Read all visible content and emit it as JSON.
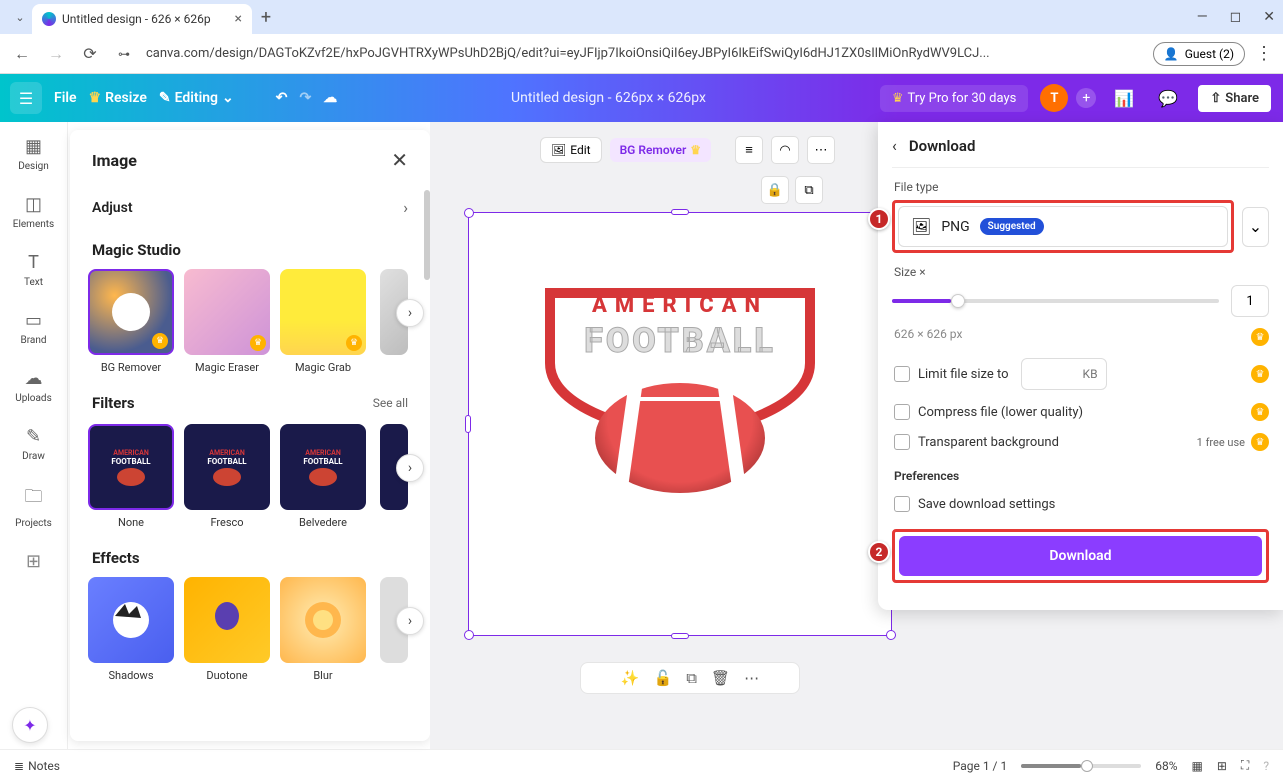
{
  "browser": {
    "tab_title": "Untitled design - 626 × 626p",
    "url": "canva.com/design/DAGToKZvf2E/hxPoJGVHTRXyWPsUhD2BjQ/edit?ui=eyJFIjp7IkoiOnsiQiI6eyJBPyI6IkEifSwiQyI6dHJ1ZX0sIlMiOnRydWV9LCJ...",
    "guest": "Guest (2)"
  },
  "appbar": {
    "file": "File",
    "resize": "Resize",
    "editing": "Editing",
    "title": "Untitled design - 626px × 626px",
    "try_pro": "Try Pro for 30 days",
    "avatar_initial": "T",
    "share": "Share"
  },
  "nav": {
    "design": "Design",
    "elements": "Elements",
    "text": "Text",
    "brand": "Brand",
    "uploads": "Uploads",
    "draw": "Draw",
    "projects": "Projects"
  },
  "panel": {
    "title": "Image",
    "adjust": "Adjust",
    "magic_studio": "Magic Studio",
    "ms": {
      "bgremover": "BG Remover",
      "eraser": "Magic Eraser",
      "grab": "Magic Grab"
    },
    "filters": "Filters",
    "see_all": "See all",
    "filter": {
      "none": "None",
      "fresco": "Fresco",
      "belvedere": "Belvedere"
    },
    "effects": "Effects",
    "fx": {
      "shadows": "Shadows",
      "duotone": "Duotone",
      "blur": "Blur"
    }
  },
  "canvas_toolbar": {
    "edit": "Edit",
    "bgremover": "BG Remover"
  },
  "logo": {
    "line1": "AMERICAN",
    "line2": "FOOTBALL"
  },
  "download": {
    "title": "Download",
    "file_type_label": "File type",
    "file_type": "PNG",
    "suggested": "Suggested",
    "size_label": "Size ×",
    "size_value": "1",
    "dim_text": "626 × 626 px",
    "limit": "Limit file size to",
    "kb": "KB",
    "compress": "Compress file (lower quality)",
    "transparent": "Transparent background",
    "free_use": "1 free use",
    "prefs": "Preferences",
    "save_settings": "Save download settings",
    "button": "Download"
  },
  "footer": {
    "notes": "Notes",
    "page": "Page 1 / 1",
    "zoom": "68%"
  }
}
